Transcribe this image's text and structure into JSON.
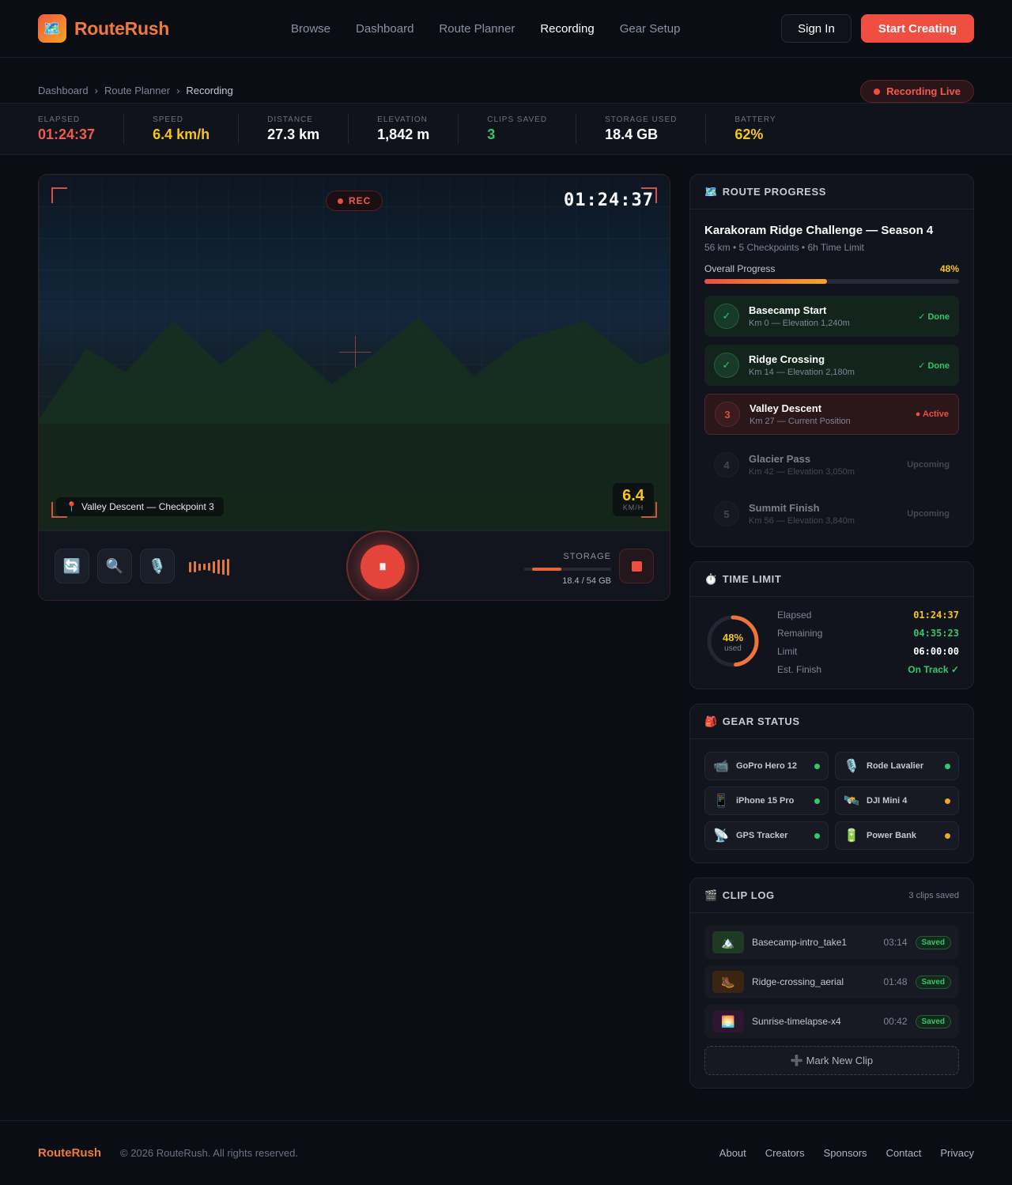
{
  "brand": {
    "name": "RouteRush",
    "icon": "map-icon",
    "accent": "#f07a3c"
  },
  "nav": {
    "links": [
      "Browse",
      "Dashboard",
      "Route Planner",
      "Recording",
      "Gear Setup"
    ],
    "active": "Recording",
    "sign_in": "Sign In",
    "start_creating": "Start Creating"
  },
  "breadcrumb": {
    "items": [
      "Dashboard",
      "Route Planner",
      "Recording"
    ],
    "separator": "›"
  },
  "status_pill": "Recording Live",
  "stats": [
    {
      "label": "Elapsed",
      "value": "01:24:37",
      "color": "#f15a4d"
    },
    {
      "label": "Speed",
      "value": "6.4 km/h",
      "color": "#f5c518"
    },
    {
      "label": "Distance",
      "value": "27.3 km",
      "color": "#ffffff"
    },
    {
      "label": "Elevation",
      "value": "1,842 m",
      "color": "#ffffff"
    },
    {
      "label": "Clips Saved",
      "value": "3",
      "color": "#35c76a"
    },
    {
      "label": "Storage Used",
      "value": "18.4 GB",
      "color": "#ffffff"
    },
    {
      "label": "Battery",
      "value": "62%",
      "color": "#f5c518"
    }
  ],
  "camera": {
    "rec_label": "REC",
    "timer": "01:24:37",
    "location_icon": "pin-icon",
    "location": "Valley Descent — Checkpoint 3",
    "speed_value": "6.4",
    "speed_unit": "KM/H",
    "controls": [
      "flip-camera-icon",
      "zoom-icon",
      "microphone-icon"
    ],
    "audio_levels": [
      0.5,
      0.55,
      0.3,
      0.2,
      0.35,
      0.6,
      0.75,
      0.85,
      0.95
    ],
    "pause_symbol": "⏸",
    "storage_label": "STORAGE",
    "storage_value": "18.4 / 54 GB",
    "storage_fraction": 0.34
  },
  "route_progress": {
    "header_icon": "map-icon",
    "header": "ROUTE PROGRESS",
    "title": "Karakoram Ridge Challenge — Season 4",
    "subtitle": "56 km • 5 Checkpoints • 6h Time Limit",
    "progress_label": "Overall Progress",
    "progress_value": "48%",
    "progress_fraction": 0.48,
    "checkpoints": [
      {
        "badge": "✓",
        "name": "Basecamp Start",
        "detail": "Km 0 — Elevation 1,240m",
        "status": "✓ Done",
        "state": "done"
      },
      {
        "badge": "✓",
        "name": "Ridge Crossing",
        "detail": "Km 14 — Elevation 2,180m",
        "status": "✓ Done",
        "state": "done"
      },
      {
        "badge": "3",
        "name": "Valley Descent",
        "detail": "Km 27 — Current Position",
        "status": "● Active",
        "state": "active"
      },
      {
        "badge": "4",
        "name": "Glacier Pass",
        "detail": "Km 42 — Elevation 3,050m",
        "status": "Upcoming",
        "state": "up"
      },
      {
        "badge": "5",
        "name": "Summit Finish",
        "detail": "Km 56 — Elevation 3,840m",
        "status": "Upcoming",
        "state": "up"
      }
    ]
  },
  "time_limit": {
    "header_icon": "stopwatch-icon",
    "header": "TIME LIMIT",
    "percent": "48%",
    "used_label": "used",
    "fraction": 0.48,
    "rows": [
      {
        "key": "Elapsed",
        "value": "01:24:37",
        "color": "#f5c518"
      },
      {
        "key": "Remaining",
        "value": "04:35:23",
        "color": "#35c76a"
      },
      {
        "key": "Limit",
        "value": "06:00:00",
        "color": "#ffffff"
      },
      {
        "key": "Est. Finish",
        "value": "On Track ✓",
        "color": "#35c76a"
      }
    ]
  },
  "gear_status": {
    "header_icon": "backpack-icon",
    "header": "GEAR STATUS",
    "items": [
      {
        "icon": "📹",
        "name": "GoPro Hero 12",
        "status": "#35c76a"
      },
      {
        "icon": "🎙️",
        "name": "Rode Lavalier",
        "status": "#35c76a"
      },
      {
        "icon": "📱",
        "name": "iPhone 15 Pro",
        "status": "#35c76a"
      },
      {
        "icon": "🛰️",
        "name": "DJI Mini 4",
        "status": "#f5a623"
      },
      {
        "icon": "📡",
        "name": "GPS Tracker",
        "status": "#35c76a"
      },
      {
        "icon": "🔋",
        "name": "Power Bank",
        "status": "#f5a623"
      }
    ]
  },
  "clip_log": {
    "header_icon": "clapper-icon",
    "header": "CLIP LOG",
    "count": "3 clips saved",
    "clips": [
      {
        "thumb": "🏔️",
        "bg": "#1e3a22",
        "name": "Basecamp-intro_take1",
        "duration": "03:14",
        "status": "Saved"
      },
      {
        "thumb": "🥾",
        "bg": "#3a2412",
        "name": "Ridge-crossing_aerial",
        "duration": "01:48",
        "status": "Saved"
      },
      {
        "thumb": "🌅",
        "bg": "#2e1630",
        "name": "Sunrise-timelapse-x4",
        "duration": "00:42",
        "status": "Saved"
      }
    ],
    "mark_new": "➕ Mark New Clip"
  },
  "footer": {
    "brand": "RouteRush",
    "copyright": "© 2026 RouteRush. All rights reserved.",
    "links": [
      "About",
      "Creators",
      "Sponsors",
      "Contact",
      "Privacy"
    ]
  }
}
